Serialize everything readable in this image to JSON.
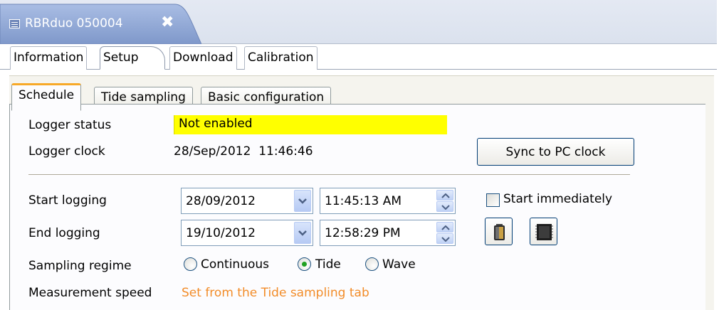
{
  "editor_tab": {
    "title": "RBRduo 050004",
    "close_glyph": "✖",
    "icon": "table-icon"
  },
  "page_tabs": [
    {
      "label": "Information",
      "active": false
    },
    {
      "label": "Setup",
      "active": true
    },
    {
      "label": "Download",
      "active": false
    },
    {
      "label": "Calibration",
      "active": false
    }
  ],
  "inner_tabs": [
    {
      "label": "Schedule",
      "active": true
    },
    {
      "label": "Tide sampling",
      "active": false
    },
    {
      "label": "Basic configuration",
      "active": false
    }
  ],
  "schedule": {
    "logger_status_label": "Logger status",
    "logger_status_value": "Not enabled",
    "logger_clock_label": "Logger clock",
    "logger_clock_value": "28/Sep/2012  11:46:46",
    "sync_button": "Sync to PC clock",
    "start_label": "Start logging",
    "start_date": "28/09/2012",
    "start_time": "11:45:13 AM",
    "start_immediately_label": "Start immediately",
    "start_immediately_checked": false,
    "end_label": "End logging",
    "end_date": "19/10/2012",
    "end_time": "12:58:29 PM",
    "sampling_regime_label": "Sampling regime",
    "regime_options": [
      "Continuous",
      "Tide",
      "Wave"
    ],
    "regime_selected": "Tide",
    "measurement_speed_label": "Measurement speed",
    "measurement_speed_value": "Set from the Tide sampling tab"
  },
  "colors": {
    "status_highlight": "#ffff00",
    "link_orange": "#f28c28",
    "editor_tab_blue": "#8fa6d4",
    "active_tab_accent": "#f7a928",
    "radio_selected": "#21a121"
  },
  "icons": {
    "battery": "battery-icon",
    "memory": "memory-chip-icon"
  }
}
